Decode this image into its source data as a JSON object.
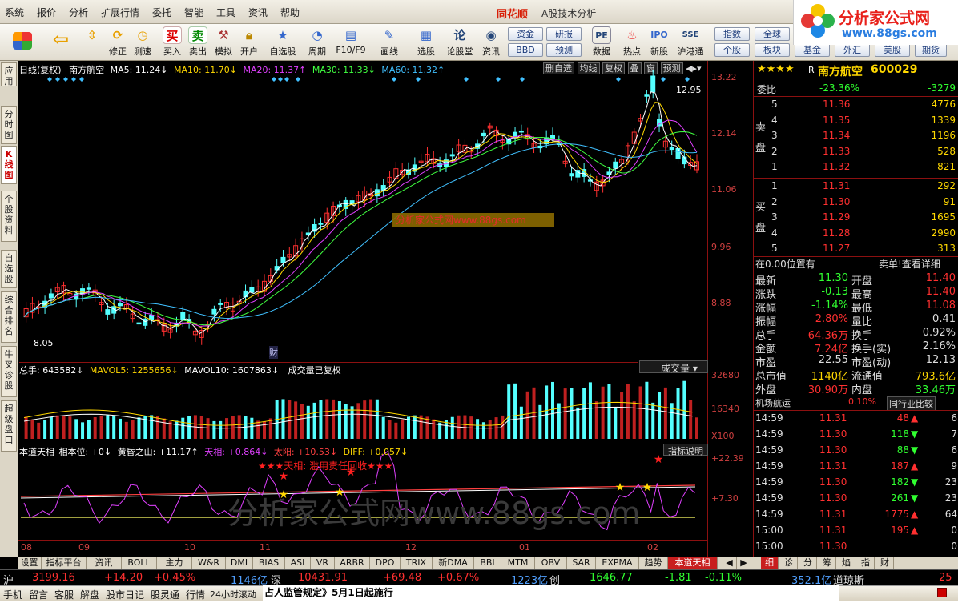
{
  "menu": {
    "items": [
      "系统",
      "报价",
      "分析",
      "扩展行情",
      "委托",
      "智能",
      "工具",
      "资讯",
      "帮助"
    ],
    "brand": "同花顺",
    "sub": "A股技术分析"
  },
  "site_logo": {
    "title": "分析家公式网",
    "url": "www.88gs.com"
  },
  "toolbar": {
    "items": [
      "",
      "",
      "修正",
      "测速",
      "买入",
      "卖出",
      "模拟",
      "开户",
      "自选股",
      "周期",
      "F10/F9",
      "画线",
      "选股",
      "论股堂",
      "资讯",
      "数据",
      "热点",
      "新股",
      "沪港通"
    ],
    "small_buttons": [
      [
        "资金",
        "研报"
      ],
      [
        "BBD",
        "预测"
      ],
      [
        "指数",
        "全球",
        "期货"
      ],
      [
        "个股",
        "板块",
        "基金",
        "外汇",
        "美股"
      ]
    ]
  },
  "left_tabs": [
    "应用",
    "分时图",
    "K线图",
    "个股资料",
    "自选股",
    "综合排名",
    "牛叉诊股",
    "超级盘口"
  ],
  "kline": {
    "header_prefix": "日线(复权)",
    "stock": "南方航空",
    "ma5": "MA5: 11.24↓",
    "ma10": "MA10: 11.70↓",
    "ma20": "MA20: 11.37↑",
    "ma30": "MA30: 11.33↓",
    "ma60": "MA60: 11.32↑",
    "header_buttons": [
      "删自选",
      "均线",
      "复权",
      "叠",
      "窗",
      "预测"
    ],
    "axis": [
      "13.22",
      "12.14",
      "11.06",
      "9.96",
      "8.88"
    ],
    "high_label": "12.95",
    "low_label": "8.05",
    "cai": "财",
    "watermark": "分析家公式网www.88gs.com"
  },
  "volume": {
    "total": "总手: 643582↓",
    "mavol5": "MAVOL5: 1255656↓",
    "mavol10": "MAVOL10: 1607863↓",
    "note": "成交量已复权",
    "selector": "成交量",
    "axis": [
      "32680",
      "16340",
      "X100"
    ]
  },
  "indicator": {
    "name": "本道天相",
    "pos": "相本位: +0↓",
    "huang": "黄昏之山: +11.17↑",
    "tian": "天相: +0.864↓",
    "taiyang": "太阳: +10.53↓",
    "diff": "DIFF: +0.057↓",
    "explain": "指标说明",
    "axis": [
      "+22.39",
      "+7.30"
    ],
    "alert": "★★★天相: 滥用责任回收★★★",
    "watermark": "分析家公式网www.88gs.com"
  },
  "xaxis": [
    "08",
    "09",
    "10",
    "11",
    "12",
    "01",
    "02"
  ],
  "quote": {
    "stars": "★★★★",
    "r": "R",
    "name": "南方航空",
    "code": "600029",
    "webi_label": "委比",
    "webi": "-23.36%",
    "weicha": "-3279",
    "sell_label": "卖盘",
    "buy_label": "买盘",
    "sell": [
      [
        "5",
        "11.36",
        "4776"
      ],
      [
        "4",
        "11.35",
        "1339"
      ],
      [
        "3",
        "11.34",
        "1196"
      ],
      [
        "2",
        "11.33",
        "528"
      ],
      [
        "1",
        "11.32",
        "821"
      ]
    ],
    "buy": [
      [
        "1",
        "11.31",
        "292"
      ],
      [
        "2",
        "11.30",
        "91"
      ],
      [
        "3",
        "11.29",
        "1695"
      ],
      [
        "4",
        "11.28",
        "2990"
      ],
      [
        "5",
        "11.27",
        "313"
      ]
    ],
    "pos_text": "在0.00位置有",
    "sell1_detail": "卖单!查看详细",
    "stats": [
      [
        "最新",
        "11.30",
        "开盘",
        "11.40"
      ],
      [
        "涨跌",
        "-0.13",
        "最高",
        "11.40"
      ],
      [
        "涨幅",
        "-1.14%",
        "最低",
        "11.08"
      ],
      [
        "振幅",
        "2.80%",
        "量比",
        "0.41"
      ],
      [
        "总手",
        "64.36万",
        "换手",
        "0.92%"
      ],
      [
        "金额",
        "7.24亿",
        "换手(实)",
        "2.16%"
      ],
      [
        "市盈",
        "22.55",
        "市盈(动)",
        "12.13"
      ],
      [
        "总市值",
        "1140亿",
        "流通值",
        "793.6亿"
      ],
      [
        "外盘",
        "30.90万",
        "内盘",
        "33.46万"
      ]
    ],
    "industry": "机场航运",
    "industry_pct": "0.10%",
    "compare": "同行业比较",
    "ticks": [
      [
        "14:59",
        "11.31",
        "48",
        "6"
      ],
      [
        "14:59",
        "11.30",
        "118",
        "7"
      ],
      [
        "14:59",
        "11.30",
        "88",
        "6"
      ],
      [
        "14:59",
        "11.31",
        "187",
        "9"
      ],
      [
        "14:59",
        "11.30",
        "182",
        "23"
      ],
      [
        "14:59",
        "11.30",
        "261",
        "23"
      ],
      [
        "14:59",
        "11.31",
        "1775",
        "64"
      ],
      [
        "15:00",
        "11.31",
        "195",
        "0"
      ],
      [
        "15:00",
        "11.30",
        "",
        "0"
      ]
    ]
  },
  "indicator_tabs": [
    "设置",
    "指标平台",
    "资讯",
    "BOLL",
    "主力",
    "W&R",
    "DMI",
    "BIAS",
    "ASI",
    "VR",
    "ARBR",
    "DPO",
    "TRIX",
    "新DMA",
    "BBI",
    "MTM",
    "OBV",
    "SAR",
    "EXPMA",
    "趋势",
    "本道天相"
  ],
  "right_tabs": [
    "细",
    "诊",
    "分",
    "筹",
    "焰",
    "指",
    "财"
  ],
  "status": {
    "sh": "沪",
    "sh_val": "3199.16",
    "sh_chg": "+14.20",
    "sh_pct": "+0.45%",
    "sh_amt": "1146亿",
    "sz": "深",
    "sz_val": "10431.91",
    "sz_chg": "+69.48",
    "sz_pct": "+0.67%",
    "sz_amt": "1223亿",
    "cy": "创",
    "cy_val": "1646.77",
    "cy_chg": "-1.81",
    "cy_pct": "-0.11%",
    "cy_amt": "352.1亿",
    "dj": "道琼斯",
    "dj_val": "25"
  },
  "bottom": {
    "items": [
      "手机",
      "留言",
      "客服",
      "解盘",
      "股市日记",
      "股灵通",
      "行情",
      "24小时滚动"
    ],
    "ticker": "占人监管规定》5月1日起施行"
  },
  "chart_data": {
    "type": "candlestick",
    "title": "南方航空 日线(复权)",
    "ylim": [
      8.05,
      12.95
    ],
    "x": [
      "08",
      "09",
      "10",
      "11",
      "12",
      "01",
      "02"
    ],
    "series": [
      {
        "name": "MA5",
        "values": [
          11.24
        ]
      },
      {
        "name": "MA10",
        "values": [
          11.7
        ]
      },
      {
        "name": "MA20",
        "values": [
          11.37
        ]
      },
      {
        "name": "MA30",
        "values": [
          11.33
        ]
      },
      {
        "name": "MA60",
        "values": [
          11.32
        ]
      }
    ]
  }
}
